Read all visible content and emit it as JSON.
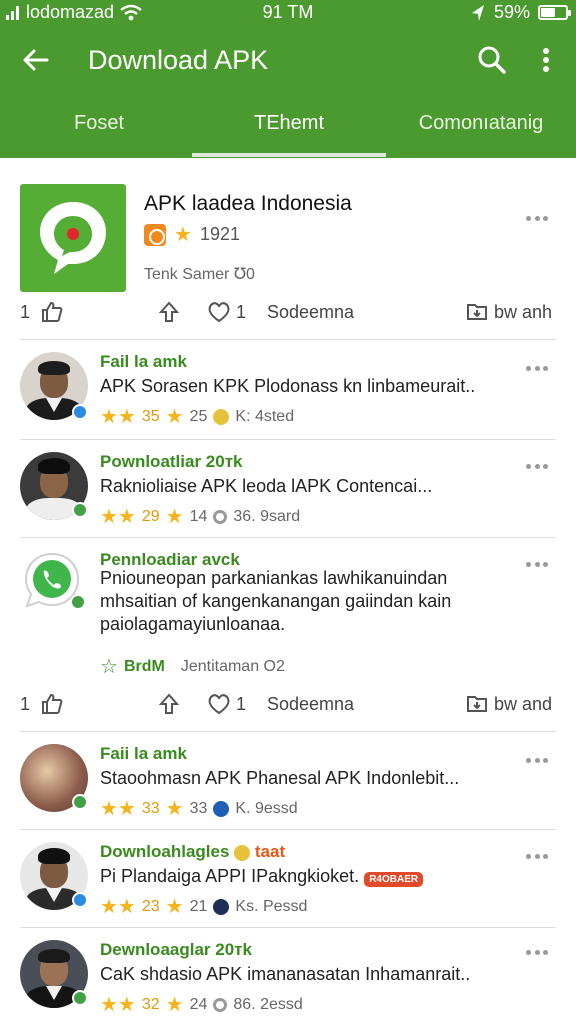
{
  "status_bar": {
    "carrier": "lodomazad",
    "time": "91 TM",
    "battery": "59%",
    "battery_level": 0.59
  },
  "app_bar": {
    "title": "Download APK"
  },
  "tabs": [
    {
      "label": "Foset"
    },
    {
      "label": "TEhemt"
    },
    {
      "label": "Comonıatanig"
    }
  ],
  "app_card": {
    "title": "APK laadea Indonesia",
    "rating_count": "1921",
    "subtitle": "Tenk Samer ℧0",
    "actions": {
      "like_count": "1",
      "comment_count": "1",
      "action_label": "Sodeemna",
      "download_label": "bw anh"
    }
  },
  "posts": [
    {
      "name": "Fail la amk",
      "text": "APK Sorasen KPK Plodonass kn linbameurait..",
      "stars": "35",
      "score": "25",
      "meta": "K: 4sted"
    },
    {
      "name": "Pownloatliar 20тk",
      "text": "Raknioliaise APK leoda lAPK Contencai...",
      "stars": "29",
      "score": "14",
      "meta": "36. 9sard"
    },
    {
      "name": "Pennloadiar avck",
      "lines": [
        "Pniouneopan parkaniankas lawhikanuindan",
        "mhsaitian of kangenkanangan gaiindan kain",
        "paiolagamayiunloanaa."
      ],
      "footer_label": "BrdM",
      "footer_meta": "Jentitaman O2",
      "actions": {
        "like_count": "1",
        "comment_count": "1",
        "action_label": "Sodeemna",
        "download_label": "bw and"
      }
    },
    {
      "name": "Faii la amk",
      "text": "Staoohmasn APK Phanesal APK Indonlebit...",
      "stars": "33",
      "score": "33",
      "meta": "K. 9essd"
    },
    {
      "name": "Downloahlagles",
      "name_extra": "taat",
      "text": "Pi Plandaiga APPI IPakngkioket.",
      "tag": "R4OBAER",
      "stars": "23",
      "score": "21",
      "meta": "Ks. Pessd"
    },
    {
      "name": "Dewnloaaglar 20тk",
      "text": "CaK shdasio APK imananasatan Inhamanrait..",
      "stars": "32",
      "score": "24",
      "meta": "86. 2essd"
    }
  ],
  "colors": {
    "primary": "#4b9a2f",
    "accent_star": "#f4b41a",
    "verify_blue": "#2b8be3",
    "verify_green": "#43a047"
  },
  "icons": [
    "back-arrow-icon",
    "search-icon",
    "more-vert-icon",
    "wifi-icon",
    "location-arrow-icon"
  ]
}
